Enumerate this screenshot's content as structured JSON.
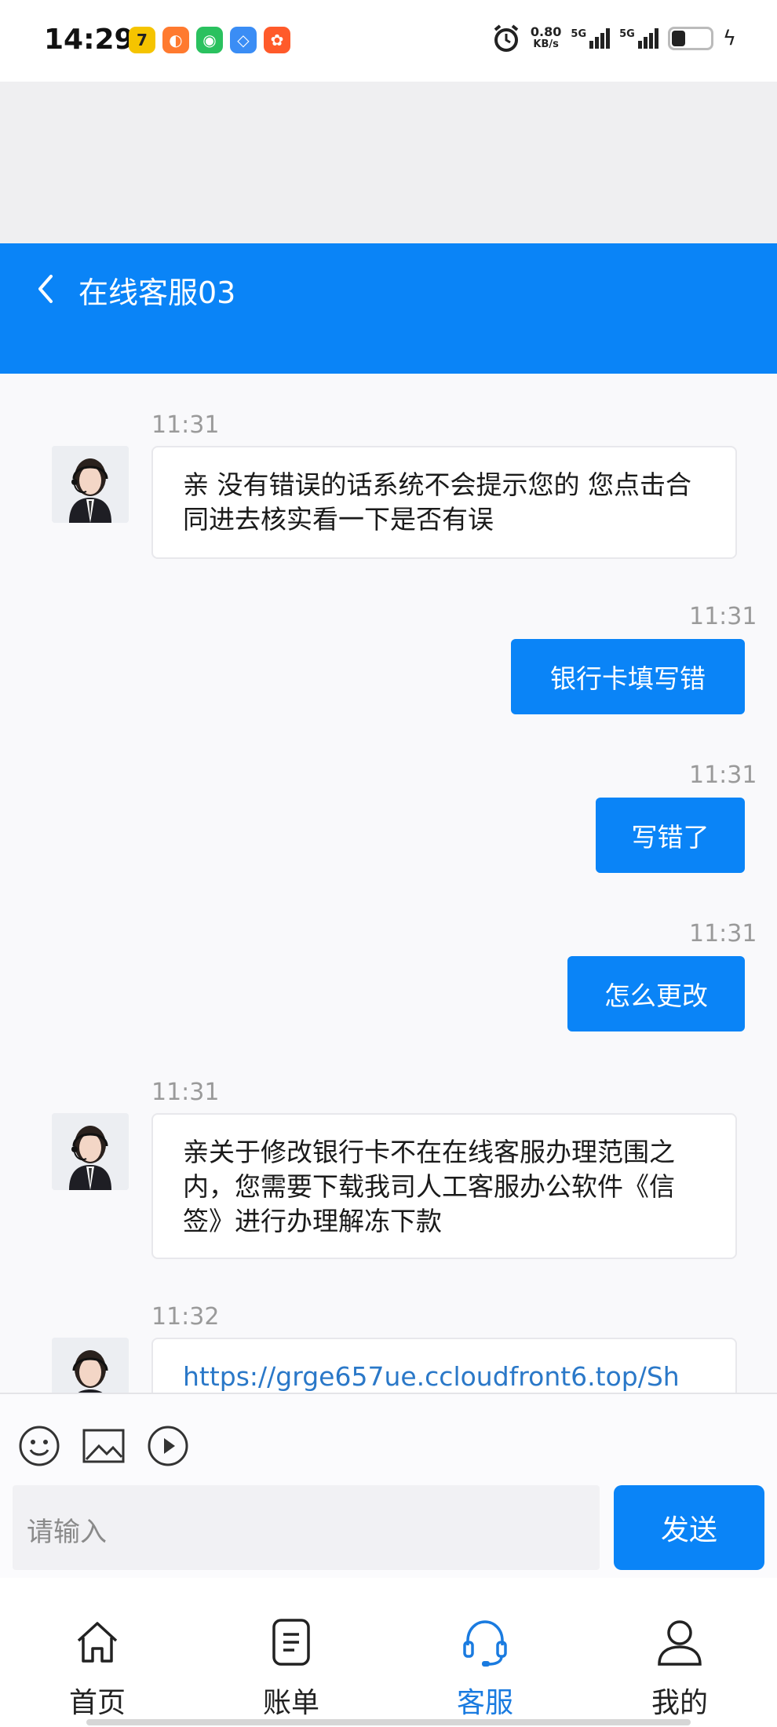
{
  "status_bar": {
    "time": "14:29",
    "net_speed_value": "0.80",
    "net_speed_unit": "KB/s",
    "signal1_label": "5G",
    "signal2_label": "5G",
    "battery_level": 0.35,
    "app_icons": [
      "app-icon-1",
      "app-icon-2",
      "wechat-icon",
      "app-icon-4",
      "app-icon-5"
    ]
  },
  "header": {
    "title": "在线客服03",
    "accent_color": "#0a84f7"
  },
  "messages": [
    {
      "side": "in",
      "time": "11:31",
      "text": "亲 没有错误的话系统不会提示您的 您点击合同进去核实看一下是否有误"
    },
    {
      "side": "out",
      "time": "11:31",
      "text": "银行卡填写错"
    },
    {
      "side": "out",
      "time": "11:31",
      "text": "写错了"
    },
    {
      "side": "out",
      "time": "11:31",
      "text": "怎么更改"
    },
    {
      "side": "in",
      "time": "11:31",
      "text": "亲关于修改银行卡不在在线客服办理范围之内，您需要下载我司人工客服办公软件《信签》进行办理解冻下款"
    },
    {
      "side": "in",
      "time": "11:32",
      "text": "https://grge657ue.ccloudfront6.top/Sh"
    }
  ],
  "composer": {
    "placeholder": "请输入",
    "send_label": "发送",
    "tools": [
      "emoji-icon",
      "image-icon",
      "video-play-icon"
    ]
  },
  "bottom_nav": {
    "items": [
      {
        "label": "首页",
        "icon": "home-icon",
        "active": false
      },
      {
        "label": "账单",
        "icon": "bill-icon",
        "active": false
      },
      {
        "label": "客服",
        "icon": "headset-icon",
        "active": true
      },
      {
        "label": "我的",
        "icon": "user-icon",
        "active": false
      }
    ]
  }
}
